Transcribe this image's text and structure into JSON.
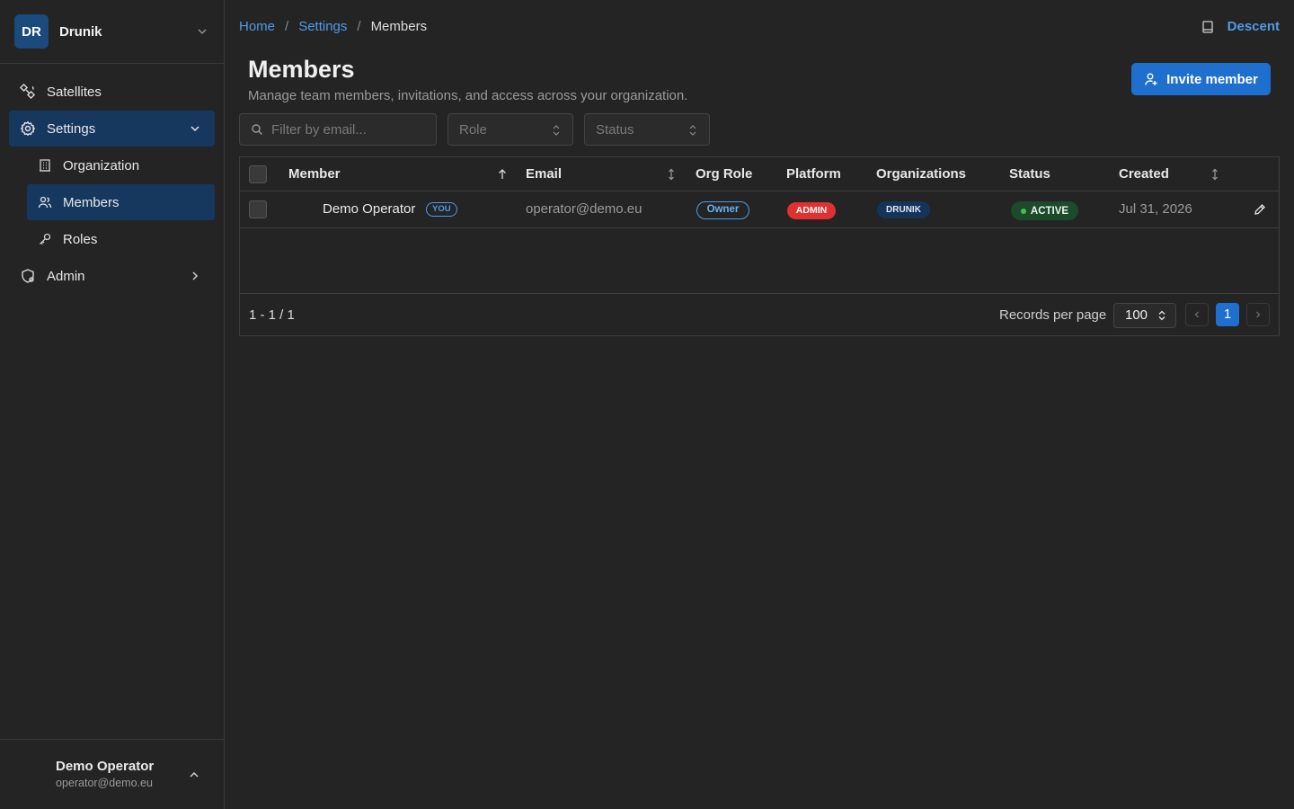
{
  "sidebar": {
    "org": {
      "initials": "DR",
      "name": "Drunik"
    },
    "items": [
      {
        "label": "Satellites",
        "icon": "satellite-icon"
      },
      {
        "label": "Settings",
        "icon": "gear-icon",
        "expanded": true
      },
      {
        "label": "Admin",
        "icon": "shield-icon"
      }
    ],
    "settings_sub": [
      {
        "label": "Organization",
        "icon": "building-icon"
      },
      {
        "label": "Members",
        "icon": "users-icon",
        "selected": true
      },
      {
        "label": "Roles",
        "icon": "key-icon"
      }
    ],
    "user": {
      "name": "Demo Operator",
      "email": "operator@demo.eu"
    }
  },
  "breadcrumb": {
    "home": "Home",
    "settings": "Settings",
    "current": "Members",
    "sep": "/"
  },
  "top_right": {
    "link": "Descent",
    "icon": "book-icon"
  },
  "header": {
    "title": "Members",
    "subtitle": "Manage team members, invitations, and access across your organization.",
    "invite_label": "Invite member"
  },
  "filters": {
    "email_placeholder": "Filter by email...",
    "role_placeholder": "Role",
    "status_placeholder": "Status"
  },
  "table": {
    "columns": [
      "Member",
      "Email",
      "Org Role",
      "Platform",
      "Organizations",
      "Status",
      "Created"
    ],
    "rows": [
      {
        "member": "Demo Operator",
        "you_badge": "YOU",
        "email": "operator@demo.eu",
        "org_role": "Owner",
        "platform": "ADMIN",
        "organizations": "DRUNIK",
        "status": "ACTIVE",
        "created": "Jul 31, 2026"
      }
    ],
    "footer": {
      "range": "1 - 1 / 1",
      "rpp_label": "Records per page",
      "rpp_value": "100",
      "current_page": "1"
    }
  },
  "colors": {
    "accent": "#1f6fcf",
    "link": "#4e9be6",
    "nav_active": "#16385f",
    "danger": "#e03131",
    "success": "#40c057"
  }
}
